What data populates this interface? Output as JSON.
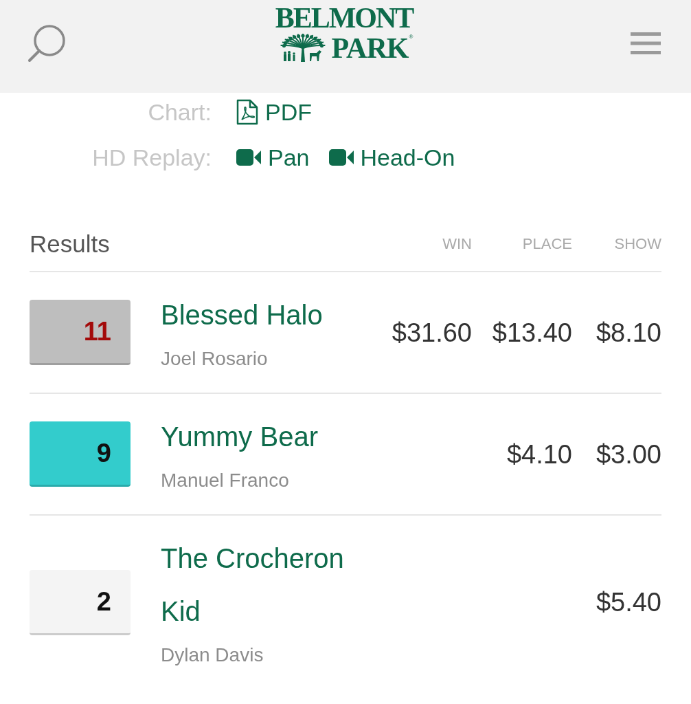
{
  "header": {
    "logo": {
      "line_1": "BELMONT",
      "line_2": "PARK",
      "mark": "®"
    }
  },
  "media": [
    {
      "label": "Chart:",
      "links": [
        {
          "kind": "pdf",
          "label": "PDF"
        }
      ]
    },
    {
      "label": "HD Replay:",
      "links": [
        {
          "kind": "video",
          "label": "Pan"
        },
        {
          "kind": "video",
          "label": "Head-On"
        }
      ]
    }
  ],
  "results": {
    "title": "Results",
    "columns": [
      "WIN",
      "PLACE",
      "SHOW"
    ],
    "rows": [
      {
        "color": "#bebebe",
        "number": {
          "label": "11",
          "color": "#a30a0a"
        },
        "horse": "Blessed Halo",
        "jockey": "Joel Rosario",
        "win": "$31.60",
        "place": "$13.40",
        "show": "$8.10"
      },
      {
        "color": "#33cccc",
        "number": {
          "label": "9",
          "color": "#111111"
        },
        "horse": "Yummy Bear",
        "jockey": "Manuel Franco",
        "place": "$4.10",
        "show": "$3.00"
      },
      {
        "color": "#f4f4f4",
        "number": {
          "label": "2",
          "color": "#111111"
        },
        "horse": "The Crocheron Kid",
        "jockey": "Dylan Davis",
        "show": "$5.40"
      }
    ]
  }
}
